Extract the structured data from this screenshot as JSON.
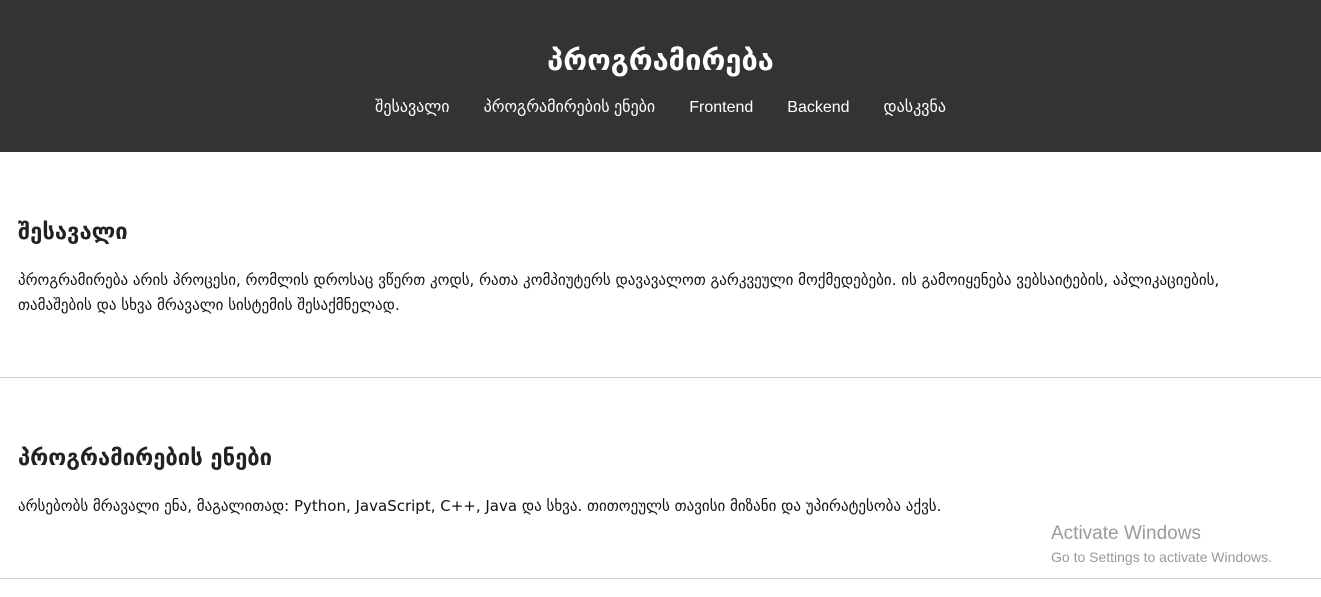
{
  "header": {
    "title": "პროგრამირება",
    "nav": [
      {
        "label": "შესავალი"
      },
      {
        "label": "პროგრამირების ენები"
      },
      {
        "label": "Frontend"
      },
      {
        "label": "Backend"
      },
      {
        "label": "დასკვნა"
      }
    ]
  },
  "sections": [
    {
      "heading": "შესავალი",
      "text": "პროგრამირება არის პროცესი, რომლის დროსაც ვწერთ კოდს, რათა კომპიუტერს დავავალოთ გარკვეული მოქმედებები. ის გამოიყენება ვებსაიტების, აპლიკაციების, თამაშების და სხვა მრავალი სისტემის შესაქმნელად."
    },
    {
      "heading": "პროგრამირების ენები",
      "text": "არსებობს მრავალი ენა, მაგალითად: Python, JavaScript, C++, Java და სხვა. თითოეულს თავისი მიზანი და უპირატესობა აქვს."
    }
  ],
  "watermark": {
    "title": "Activate Windows",
    "subtitle": "Go to Settings to activate Windows."
  },
  "colors": {
    "header_bg": "#333333",
    "header_text": "#ffffff",
    "divider": "#cccccc"
  }
}
